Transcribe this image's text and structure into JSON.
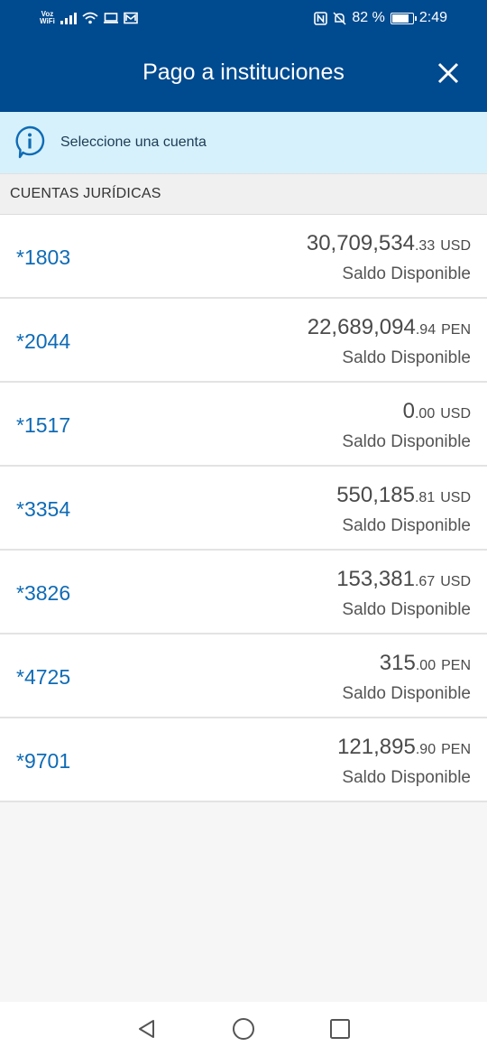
{
  "status_bar": {
    "voz_label": "Voz",
    "wifi_label": "WiFi",
    "battery_percent": "82 %",
    "time": "2:49",
    "battery_level": 0.82
  },
  "header": {
    "title": "Pago a instituciones",
    "close_icon": "close-icon"
  },
  "info_banner": {
    "icon": "info-icon",
    "text": "Seleccione una cuenta"
  },
  "section": {
    "title": "CUENTAS JURÍDICAS"
  },
  "accounts": [
    {
      "number": "*1803",
      "amount_int": "30,709,534",
      "amount_dec": ".33",
      "currency": "USD",
      "label": "Saldo Disponible"
    },
    {
      "number": "*2044",
      "amount_int": "22,689,094",
      "amount_dec": ".94",
      "currency": "PEN",
      "label": "Saldo Disponible"
    },
    {
      "number": "*1517",
      "amount_int": "0",
      "amount_dec": ".00",
      "currency": "USD",
      "label": "Saldo Disponible"
    },
    {
      "number": "*3354",
      "amount_int": "550,185",
      "amount_dec": ".81",
      "currency": "USD",
      "label": "Saldo Disponible"
    },
    {
      "number": "*3826",
      "amount_int": "153,381",
      "amount_dec": ".67",
      "currency": "USD",
      "label": "Saldo Disponible"
    },
    {
      "number": "*4725",
      "amount_int": "315",
      "amount_dec": ".00",
      "currency": "PEN",
      "label": "Saldo Disponible"
    },
    {
      "number": "*9701",
      "amount_int": "121,895",
      "amount_dec": ".90",
      "currency": "PEN",
      "label": "Saldo Disponible"
    }
  ],
  "colors": {
    "brand_blue": "#004a8f",
    "account_link": "#0f6bb5",
    "banner_bg": "#d6f1fb"
  },
  "nav": {
    "back_icon": "back-triangle-icon",
    "home_icon": "home-circle-icon",
    "recents_icon": "recents-square-icon"
  }
}
